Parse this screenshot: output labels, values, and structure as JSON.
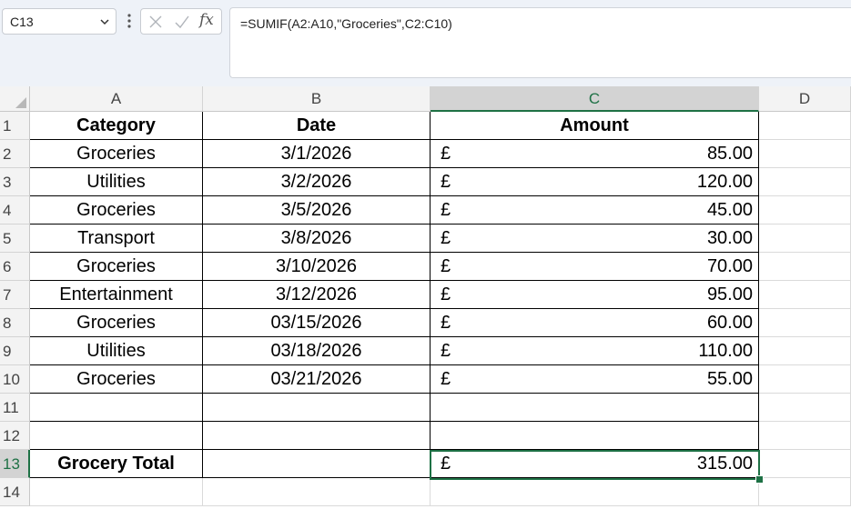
{
  "name_box": {
    "value": "C13"
  },
  "formula_bar": {
    "fx_label": "fx",
    "formula": "=SUMIF(A2:A10,\"Groceries\",C2:C10)"
  },
  "columns": [
    "A",
    "B",
    "C",
    "D"
  ],
  "rows": [
    "1",
    "2",
    "3",
    "4",
    "5",
    "6",
    "7",
    "8",
    "9",
    "10",
    "11",
    "12",
    "13",
    "14"
  ],
  "active_cell": {
    "column": "C",
    "row": "13"
  },
  "headers": {
    "category": "Category",
    "date": "Date",
    "amount": "Amount"
  },
  "data_rows": [
    {
      "category": "Groceries",
      "date": "3/1/2026",
      "currency": "£",
      "amount": "85.00"
    },
    {
      "category": "Utilities",
      "date": "3/2/2026",
      "currency": "£",
      "amount": "120.00"
    },
    {
      "category": "Groceries",
      "date": "3/5/2026",
      "currency": "£",
      "amount": "45.00"
    },
    {
      "category": "Transport",
      "date": "3/8/2026",
      "currency": "£",
      "amount": "30.00"
    },
    {
      "category": "Groceries",
      "date": "3/10/2026",
      "currency": "£",
      "amount": "70.00"
    },
    {
      "category": "Entertainment",
      "date": "3/12/2026",
      "currency": "£",
      "amount": "95.00"
    },
    {
      "category": "Groceries",
      "date": "03/15/2026",
      "currency": "£",
      "amount": "60.00"
    },
    {
      "category": "Utilities",
      "date": "03/18/2026",
      "currency": "£",
      "amount": "110.00"
    },
    {
      "category": "Groceries",
      "date": "03/21/2026",
      "currency": "£",
      "amount": "55.00"
    }
  ],
  "total_row": {
    "label": "Grocery Total",
    "currency": "£",
    "amount": "315.00"
  },
  "colors": {
    "selection": "#1e7145",
    "header_bg": "#f3f3f3",
    "formula_bg": "#eef2f8"
  }
}
